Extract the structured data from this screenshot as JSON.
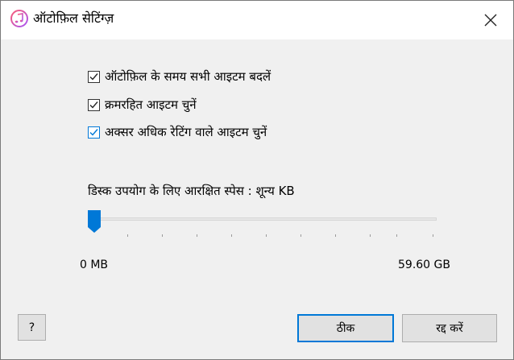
{
  "window": {
    "title": "ऑटोफ़िल सेटिंग्ज़",
    "app_icon": "itunes-music-note-icon",
    "close_icon": "close-icon"
  },
  "options": [
    {
      "label": "ऑटोफ़िल के समय सभी आइटम बदलें",
      "checked": true
    },
    {
      "label": "क्रमरहित आइटम चुनें",
      "checked": true
    },
    {
      "label": "अक्सर अधिक रेटिंग वाले आइटम चुनें",
      "checked": true,
      "focused": true
    }
  ],
  "disk_space": {
    "label": "डिस्क उपयोग के लिए आरक्षित स्पेस : शून्य KB",
    "min_label": "0 MB",
    "max_label": "59.60 GB",
    "slider_fraction": 0
  },
  "buttons": {
    "help": "?",
    "ok": "ठीक",
    "cancel": "रद्द करें"
  },
  "colors": {
    "accent": "#0078d7",
    "dialog_bg": "#f0f0f0"
  }
}
